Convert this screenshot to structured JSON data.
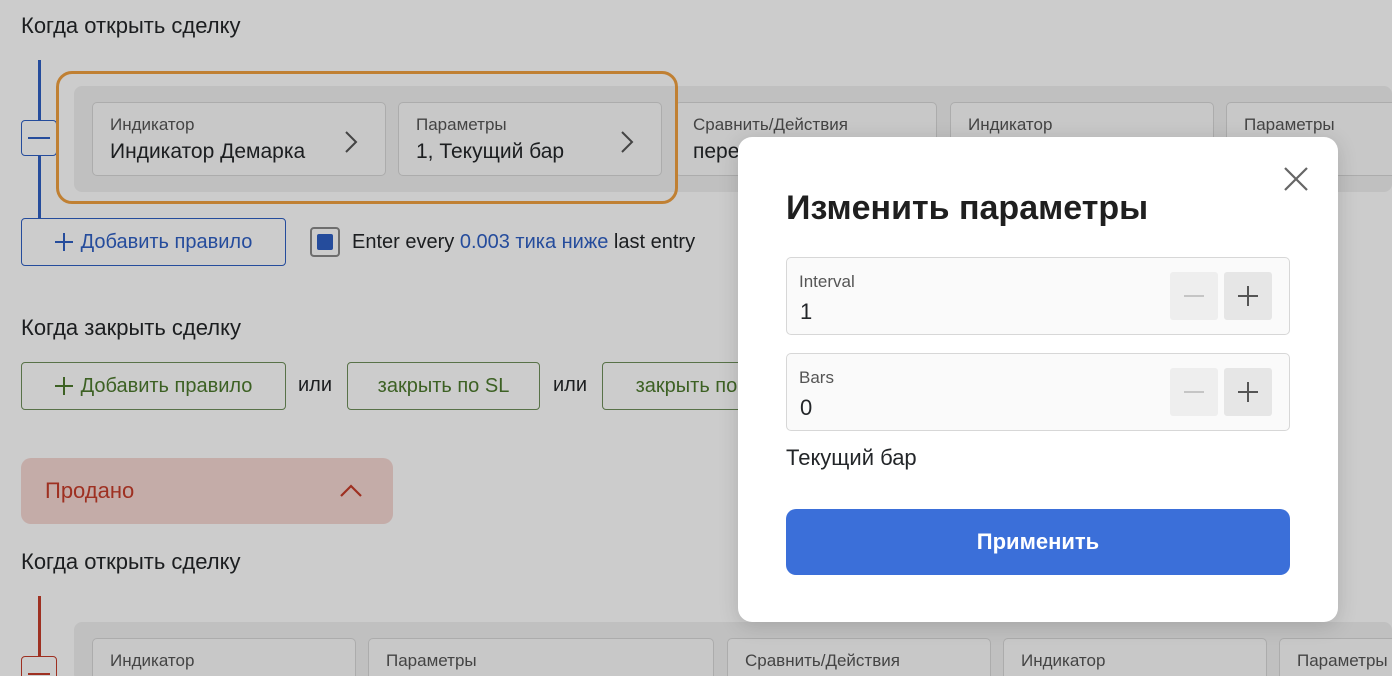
{
  "entry_section": {
    "title": "Когда открыть сделку",
    "rule_cards": [
      {
        "label": "Индикатор",
        "value": "Индикатор Демарка"
      },
      {
        "label": "Параметры",
        "value": "1, Текущий бар"
      },
      {
        "label": "Сравнить/Действия",
        "value": "пересекает"
      },
      {
        "label": "Индикатор",
        "value": ""
      },
      {
        "label": "Параметры",
        "value": ""
      }
    ],
    "add_rule_label": "Добавить правило",
    "entry_every": {
      "prefix": "Enter every",
      "link": "0.003 тика ниже",
      "suffix": "last entry",
      "checked": true
    }
  },
  "exit_section": {
    "title": "Когда закрыть сделку",
    "add_rule_label": "Добавить правило",
    "or_1": "или",
    "close_sl_label": "закрыть по SL",
    "or_2": "или",
    "close_tp_label": "закрыть по TP"
  },
  "sold_section": {
    "label": "Продано",
    "expanded": true,
    "title": "Когда открыть сделку",
    "rule_cards": [
      {
        "label": "Индикатор"
      },
      {
        "label": "Параметры"
      },
      {
        "label": "Сравнить/Действия"
      },
      {
        "label": "Индикатор"
      },
      {
        "label": "Параметры"
      }
    ]
  },
  "modal": {
    "title": "Изменить параметры",
    "fields": [
      {
        "label": "Interval",
        "value": "1"
      },
      {
        "label": "Bars",
        "value": "0"
      }
    ],
    "hint": "Текущий бар",
    "apply_label": "Применить"
  },
  "colors": {
    "accent_blue": "#3b6fd9",
    "highlight_orange": "#f0a040",
    "sold_red": "#c63c2a",
    "green": "#4d7a2e"
  }
}
